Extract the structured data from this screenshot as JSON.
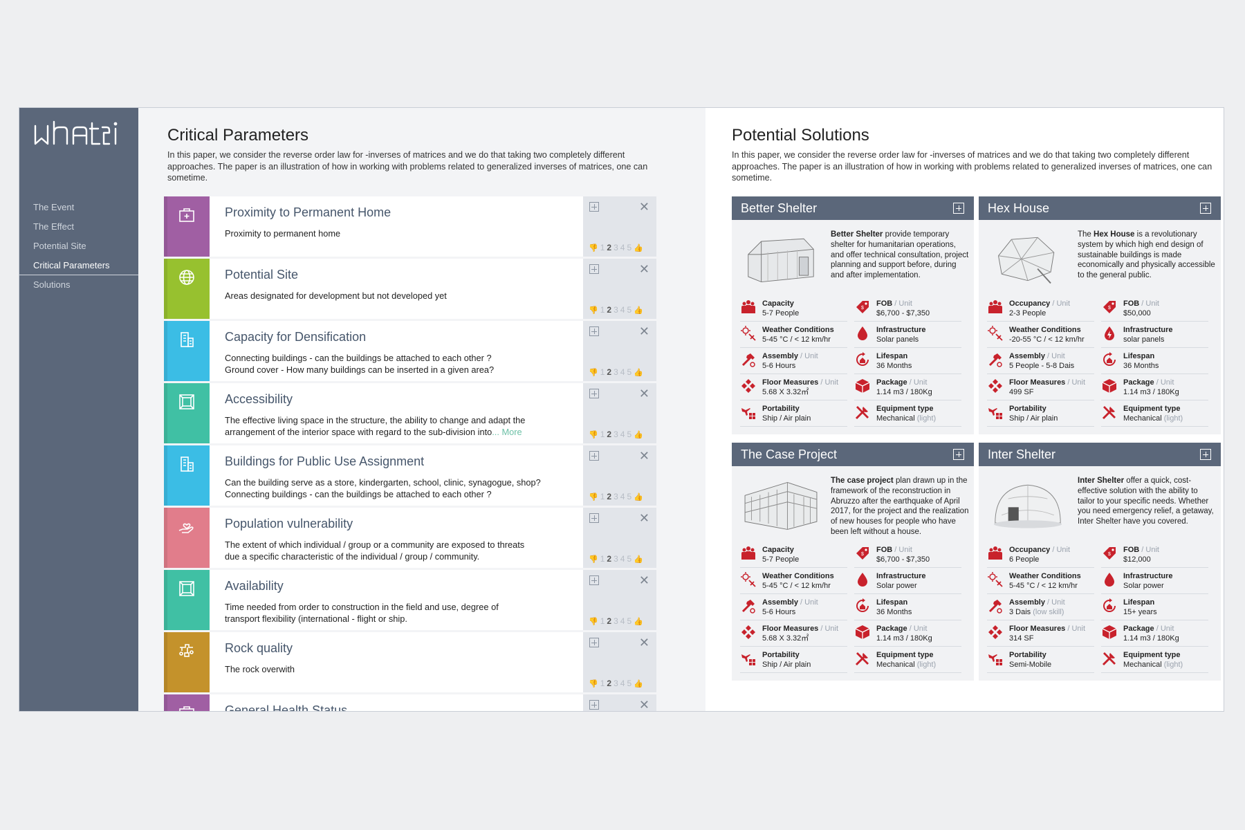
{
  "app": {
    "logo_text": "whati"
  },
  "nav": [
    "The Event",
    "The Effect",
    "Potential Site",
    "Critical Parameters",
    "Solutions"
  ],
  "nav_active": 3,
  "left": {
    "title": "Critical Parameters",
    "desc": "In this paper, we consider the reverse order law for -inverses of matrices and we do that taking two completely different approaches. The paper is an illustration of how in working with problems related to generalized inverses of matrices, one can sometime."
  },
  "right": {
    "title": "Potential Solutions",
    "desc": "In this paper, we consider the reverse order law for -inverses of matrices and we do that taking two completely different approaches. The paper is an illustration of how in working with problems related to generalized inverses of matrices, one can sometime."
  },
  "rating": {
    "scale": [
      "1",
      "2",
      "3",
      "4",
      "5"
    ],
    "selected": 2
  },
  "more_label": "... More",
  "params": [
    {
      "title": "Proximity to Permanent Home",
      "desc": "Proximity to permanent home",
      "color": "#a05fa3",
      "icon": "medkit-icon"
    },
    {
      "title": "Potential Site",
      "desc": "Areas designated for development but not developed yet",
      "color": "#97c12f",
      "icon": "globe-icon"
    },
    {
      "title": "Capacity for Densification",
      "desc": "Connecting buildings -  can the buildings be attached to each other ?",
      "desc2": "Ground cover - How many buildings can be inserted in a given area?",
      "color": "#3bbde5",
      "icon": "buildings-icon"
    },
    {
      "title": "Accessibility",
      "desc": "The effective living space in the structure, the ability to change and adapt the",
      "desc2": "arrangement of the interior space with regard to the sub-division into",
      "more": true,
      "color": "#40c0a4",
      "icon": "cube-icon"
    },
    {
      "title": "Buildings for Public Use Assignment",
      "desc": "Can the building serve as a store, kindergarten, school, clinic, synagogue, shop?",
      "desc2": "Connecting buildings -  can the buildings be attached to each other ?",
      "color": "#3bbde5",
      "icon": "buildings-icon"
    },
    {
      "title": "Population vulnerability",
      "desc": "The extent of which individual / group or a community are exposed to threats",
      "desc2": "due a specific characteristic of the individual / group / community.",
      "color": "#e17d8b",
      "icon": "hand-heart-icon"
    },
    {
      "title": "Availability",
      "desc": "Time needed from order to construction in the field and use, degree of",
      "desc2": "transport flexibility (international - flight or ship.",
      "color": "#40c0a4",
      "icon": "cube-icon"
    },
    {
      "title": "Rock quality",
      "desc": "The rock overwith",
      "color": "#c4922b",
      "icon": "rocks-icon"
    },
    {
      "title": "General Health Status",
      "desc": "",
      "color": "#a05fa3",
      "icon": "medkit-icon"
    }
  ],
  "colors": {
    "sidebar": "#5b677a",
    "accent_red": "#c8222c",
    "more_link": "#6cc0a6"
  },
  "solutions": [
    {
      "name": "Better Shelter",
      "image": "shelter-tent-image",
      "desc_bold": "Better Shelter",
      "desc": " provide temporary shelter for humanitarian operations, and offer technical consultation, project planning and support before, during and after implementation.",
      "specs": [
        {
          "label": "Capacity",
          "unit": "",
          "value": "5-7 People",
          "light": "",
          "icon": "people-icon"
        },
        {
          "label": "FOB",
          "unit": "/ Unit",
          "value": "$6,700 - $7,350",
          "light": "",
          "icon": "price-tag-icon"
        },
        {
          "label": "Weather Conditions",
          "unit": "",
          "value": "5-45 °C / < 12 km/hr",
          "light": "",
          "icon": "weather-icon"
        },
        {
          "label": "Infrastructure",
          "unit": "",
          "value": "Solar panels",
          "light": "",
          "icon": "drop-icon"
        },
        {
          "label": "Assembly",
          "unit": "/ Unit",
          "value": "5-6 Hours",
          "light": "",
          "icon": "hammer-icon"
        },
        {
          "label": "Lifespan",
          "unit": "",
          "value": "36 Months",
          "light": "",
          "icon": "lifespan-icon"
        },
        {
          "label": "Floor Measures",
          "unit": "/ Unit",
          "value": "5.68 X 3.32㎡",
          "light": "",
          "icon": "floor-icon"
        },
        {
          "label": "Package",
          "unit": "/ Unit",
          "value": "1.14 m3  / 180Kg",
          "light": "",
          "icon": "package-icon"
        },
        {
          "label": "Portability",
          "unit": "",
          "value": "Ship / Air plain",
          "light": "",
          "icon": "plane-icon"
        },
        {
          "label": "Equipment type",
          "unit": "",
          "value": "Mechanical ",
          "light": "(light)",
          "icon": "tools-icon"
        }
      ]
    },
    {
      "name": "Hex House",
      "image": "hex-house-image",
      "desc_pre": "The ",
      "desc_bold": "Hex House",
      "desc": " is a revolutionary system by which high end design of sustainable buildings is made economically and physically accessible to the general public.",
      "specs": [
        {
          "label": "Occupancy",
          "unit": "/ Unit",
          "value": "2-3 People",
          "light": "",
          "icon": "people-icon"
        },
        {
          "label": "FOB",
          "unit": "/ Unit",
          "value": "$50,000",
          "light": "",
          "icon": "price-tag-icon"
        },
        {
          "label": "Weather Conditions",
          "unit": "",
          "value": "-20-55 °C / < 12 km/hr",
          "light": "",
          "icon": "weather-icon"
        },
        {
          "label": "Infrastructure",
          "unit": "",
          "value": "solar panels",
          "light": "",
          "icon": "bolt-drop-icon"
        },
        {
          "label": "Assembly",
          "unit": "/ Unit",
          "value": "5 People - 5-8 Dais",
          "light": "",
          "icon": "hammer-icon"
        },
        {
          "label": "Lifespan",
          "unit": "",
          "value": "36 Months",
          "light": "",
          "icon": "lifespan-icon"
        },
        {
          "label": "Floor Measures",
          "unit": "/ Unit",
          "value": "499 SF",
          "light": "",
          "icon": "floor-icon"
        },
        {
          "label": "Package",
          "unit": "/ Unit",
          "value": "1.14 m3  / 180Kg",
          "light": "",
          "icon": "package-icon"
        },
        {
          "label": "Portability",
          "unit": "",
          "value": "Ship / Air plain",
          "light": "",
          "icon": "plane-icon"
        },
        {
          "label": "Equipment type",
          "unit": "",
          "value": "Mechanical ",
          "light": "(light)",
          "icon": "tools-icon"
        }
      ]
    },
    {
      "name": "The Case Project",
      "image": "case-project-building-image",
      "desc_bold": "The case project",
      "desc": " plan drawn up in the framework of the reconstruction in Abruzzo after the earthquake of April 2017, for the project and the realization of new houses for people who have been left without a house.",
      "specs": [
        {
          "label": "Capacity",
          "unit": "",
          "value": "5-7 People",
          "light": "",
          "icon": "people-icon"
        },
        {
          "label": "FOB",
          "unit": "/ Unit",
          "value": "$6,700 - $7,350",
          "light": "",
          "icon": "price-tag-icon"
        },
        {
          "label": "Weather Conditions",
          "unit": "",
          "value": "5-45 °C / < 12 km/hr",
          "light": "",
          "icon": "weather-icon"
        },
        {
          "label": "Infrastructure",
          "unit": "",
          "value": "Solar power",
          "light": "",
          "icon": "drop-icon"
        },
        {
          "label": "Assembly",
          "unit": "/ Unit",
          "value": "5-6 Hours",
          "light": "",
          "icon": "hammer-icon"
        },
        {
          "label": "Lifespan",
          "unit": "",
          "value": "36 Months",
          "light": "",
          "icon": "lifespan-icon"
        },
        {
          "label": "Floor Measures",
          "unit": "/ Unit",
          "value": "5.68 X 3.32㎡",
          "light": "",
          "icon": "floor-icon"
        },
        {
          "label": "Package",
          "unit": "/ Unit",
          "value": "1.14 m3  / 180Kg",
          "light": "",
          "icon": "package-icon"
        },
        {
          "label": "Portability",
          "unit": "",
          "value": "Ship / Air plain",
          "light": "",
          "icon": "plane-icon"
        },
        {
          "label": "Equipment type",
          "unit": "",
          "value": "Mechanical ",
          "light": "(light)",
          "icon": "tools-icon"
        }
      ]
    },
    {
      "name": "Inter Shelter",
      "image": "dome-shelter-image",
      "desc_bold": "Inter Shelter",
      "desc": " offer a quick, cost-effective solution with the ability to tailor to your specific needs. Whether you need emergency relief, a getaway, Inter Shelter have you covered.",
      "specs": [
        {
          "label": "Occupancy",
          "unit": "/ Unit",
          "value": "6 People",
          "light": "",
          "icon": "people-icon"
        },
        {
          "label": "FOB",
          "unit": "/ Unit",
          "value": "$12,000",
          "light": "",
          "icon": "price-tag-icon"
        },
        {
          "label": "Weather Conditions",
          "unit": "",
          "value": "5-45 °C / < 12 km/hr",
          "light": "",
          "icon": "weather-icon"
        },
        {
          "label": "Infrastructure",
          "unit": "",
          "value": "Solar power",
          "light": "",
          "icon": "drop-icon"
        },
        {
          "label": "Assembly",
          "unit": "/ Unit",
          "value": "3 Dais ",
          "light": "(low skill)",
          "icon": "hammer-icon"
        },
        {
          "label": "Lifespan",
          "unit": "",
          "value": "15+ years",
          "light": "",
          "icon": "lifespan-icon"
        },
        {
          "label": "Floor Measures",
          "unit": "/ Unit",
          "value": "314 SF",
          "light": "",
          "icon": "floor-icon"
        },
        {
          "label": "Package",
          "unit": "/ Unit",
          "value": "1.14 m3  / 180Kg",
          "light": "",
          "icon": "package-icon"
        },
        {
          "label": "Portability",
          "unit": "",
          "value": "Semi-Mobile",
          "light": "",
          "icon": "plane-icon"
        },
        {
          "label": "Equipment type",
          "unit": "",
          "value": "Mechanical ",
          "light": "(light)",
          "icon": "tools-icon"
        }
      ]
    }
  ]
}
